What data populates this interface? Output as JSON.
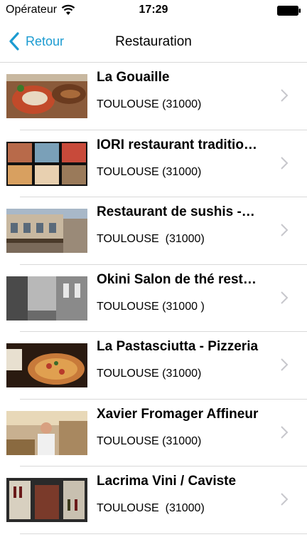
{
  "status": {
    "carrier": "Opérateur",
    "time": "17:29"
  },
  "nav": {
    "back_label": "Retour",
    "title": "Restauration"
  },
  "items": [
    {
      "name": "La Gouaille",
      "city": "TOULOUSE (31000)"
    },
    {
      "name": "IORI restaurant traditio…",
      "city": "TOULOUSE (31000)"
    },
    {
      "name": "Restaurant de sushis -…",
      "city": "TOULOUSE  (31000)"
    },
    {
      "name": "Okini Salon de thé rest…",
      "city": "TOULOUSE (31000 )"
    },
    {
      "name": "La Pastasciutta - Pizzeria",
      "city": "TOULOUSE (31000)"
    },
    {
      "name": "Xavier Fromager Affineur",
      "city": "TOULOUSE (31000)"
    },
    {
      "name": "Lacrima Vini / Caviste",
      "city": "TOULOUSE  (31000)"
    }
  ],
  "colors": {
    "accent": "#1b9bd1",
    "separator": "#d9d9d9",
    "chevron": "#c7c7cc"
  }
}
